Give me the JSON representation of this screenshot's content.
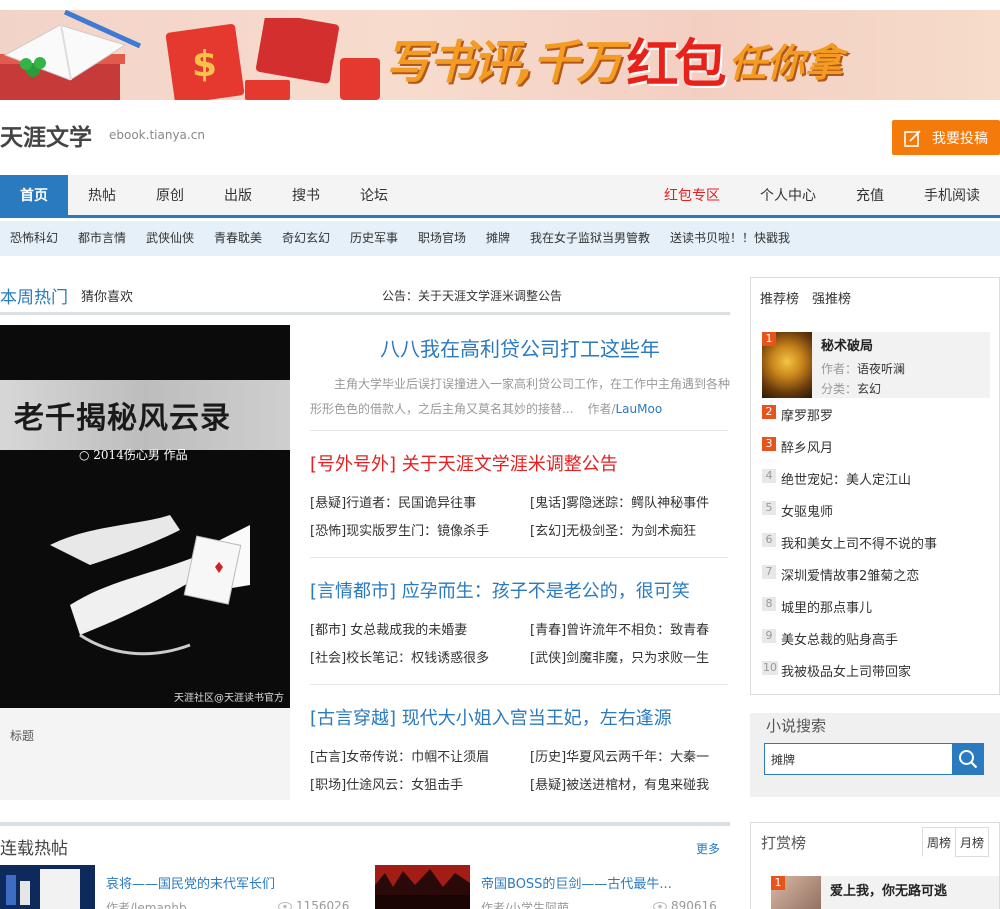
{
  "banner": {
    "slogan_part1": "写书评,千万",
    "slogan_part2": "红包",
    "slogan_part3": "任你拿"
  },
  "header": {
    "site_title": "天涯文学",
    "site_domain": "ebook.tianya.cn",
    "submit_label": "我要投稿"
  },
  "main_nav": {
    "items": [
      "首页",
      "热帖",
      "原创",
      "出版",
      "搜书",
      "论坛"
    ],
    "right_items": [
      "红包专区",
      "个人中心",
      "充值",
      "手机阅读"
    ]
  },
  "sub_nav": {
    "items": [
      "恐怖科幻",
      "都市言情",
      "武侠仙侠",
      "青春耽美",
      "奇幻玄幻",
      "历史军事",
      "职场官场",
      "摊牌",
      "我在女子监狱当男管教",
      "送读书贝啦！！快戳我"
    ]
  },
  "weekly": {
    "title": "本周热门",
    "tab2": "猜你喜欢",
    "notice": "公告：关于天涯文学涯米调整公告",
    "cover": {
      "title": "老千揭秘风云录",
      "author": "○ 2014伤心男  作品",
      "credit": "天涯社区@天涯读书官方"
    },
    "caption": "标题",
    "lead": {
      "title": "八八我在高利贷公司打工这些年",
      "summary": "主角大学毕业后误打误撞进入一家高利贷公司工作，在工作中主角遇到各种形形色色的借款人，之后主角又莫名其妙的接替...",
      "author_label": "作者/",
      "author": "LauMoo"
    },
    "groups": [
      {
        "title": "[号外号外] 关于天涯文学涯米调整公告",
        "links": [
          "[悬疑]行道者：民国诡异往事",
          "[鬼话]雾隐迷踪：鳄队神秘事件",
          "[恐怖]现实版罗生门：镜像杀手",
          "[玄幻]无极剑圣：为剑术痴狂"
        ]
      },
      {
        "title": "[言情都市] 应孕而生：孩子不是老公的，很可笑",
        "links": [
          "[都市] 女总裁成我的未婚妻",
          "[青春]曾许流年不相负：致青春",
          "[社会]校长笔记：权钱诱惑很多",
          "[武侠]剑魔非魔，只为求败一生"
        ]
      },
      {
        "title": "[古言穿越] 现代大小姐入宫当王妃，左右逢源",
        "links": [
          "[古言]女帝传说：巾帼不让须眉",
          "[历史]华夏风云两千年：大秦一",
          "[职场]仕途风云：女狙击手",
          "[悬疑]被送进棺材，有鬼来碰我"
        ]
      }
    ]
  },
  "rank": {
    "tab1": "推荐榜",
    "tab2": "强推榜",
    "top": {
      "num": "1",
      "name": "秘术破局",
      "author_label": "作者：",
      "author": "语夜听澜",
      "category_label": "分类：",
      "category": "玄幻"
    },
    "items": [
      {
        "num": "2",
        "name": "摩罗那罗"
      },
      {
        "num": "3",
        "name": "醉乡风月"
      },
      {
        "num": "4",
        "name": "绝世宠妃：美人定江山"
      },
      {
        "num": "5",
        "name": "女驱鬼师"
      },
      {
        "num": "6",
        "name": "我和美女上司不得不说的事"
      },
      {
        "num": "7",
        "name": "深圳爱情故事2雏菊之恋"
      },
      {
        "num": "8",
        "name": "城里的那点事儿"
      },
      {
        "num": "9",
        "name": "美女总裁的贴身高手"
      },
      {
        "num": "10",
        "name": "我被极品女上司带回家"
      }
    ]
  },
  "search": {
    "label": "小说搜索",
    "value": "摊牌"
  },
  "reward": {
    "label": "打赏榜",
    "tab_week": "周榜",
    "tab_month": "月榜",
    "top_num": "1",
    "top_name": "爱上我，你无路可逃"
  },
  "serial": {
    "title": "连载热帖",
    "more": "更多",
    "items": [
      {
        "title": "哀将——国民党的末代军长们",
        "author": "作者/lemanhb",
        "views": "1156026"
      },
      {
        "title": "帝国BOSS的巨剑——古代最牛...",
        "author": "作者/小学生阿萌",
        "views": "890616"
      }
    ]
  },
  "colors": {
    "brand_blue": "#2a7ac0",
    "accent_orange": "#f47a0b",
    "alert_red": "#e62020"
  }
}
